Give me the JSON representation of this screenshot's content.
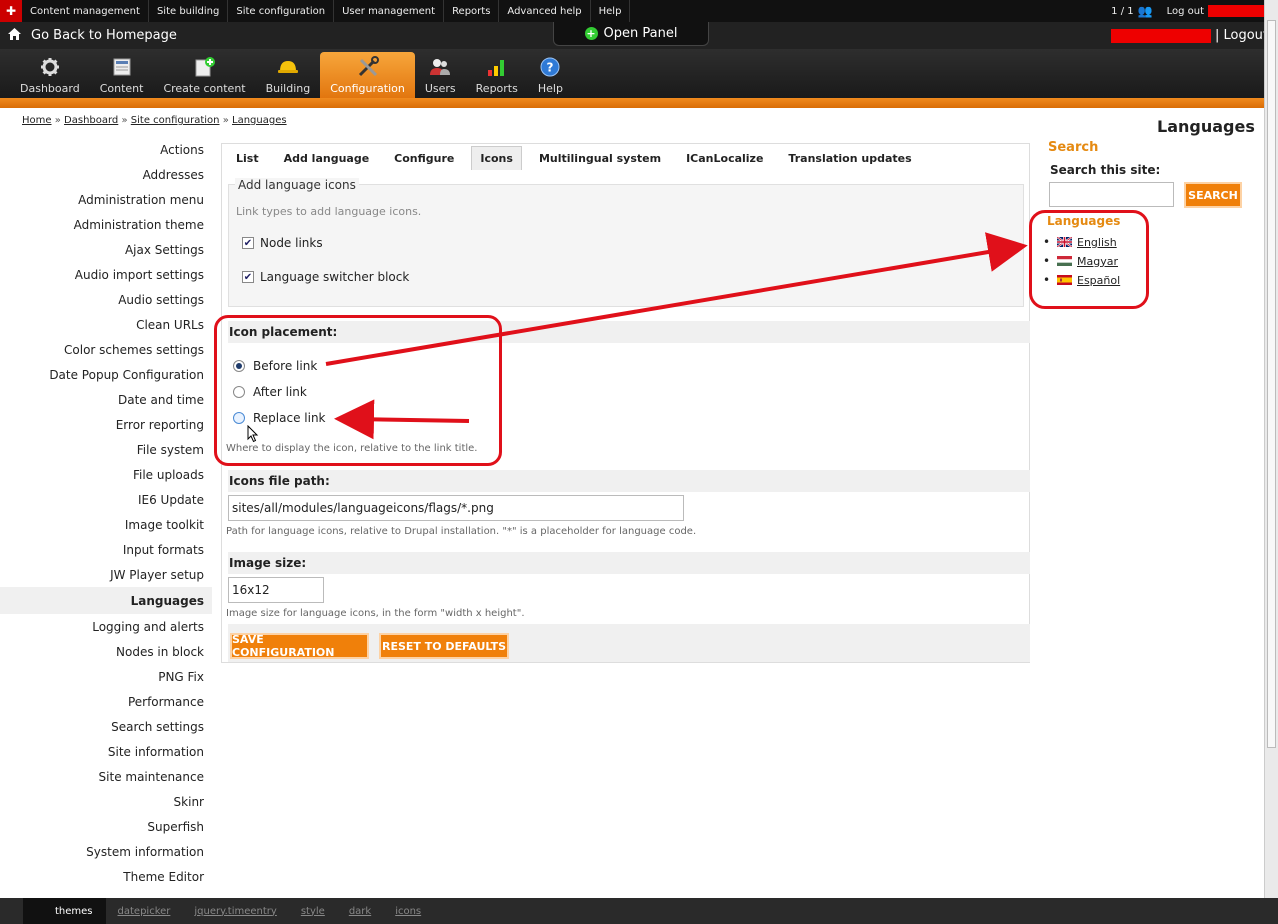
{
  "admin_menu": {
    "items": [
      "Content management",
      "Site building",
      "Site configuration",
      "User management",
      "Reports",
      "Advanced help",
      "Help"
    ],
    "user_count": "1 / 1",
    "logout_label": "Log out"
  },
  "bar2": {
    "home_label": "Go Back to Homepage",
    "open_panel_label": "Open Panel",
    "logout_label": "| Logout"
  },
  "toolbar": {
    "buttons": [
      {
        "label": "Dashboard",
        "icon": "gear-icon"
      },
      {
        "label": "Content",
        "icon": "document-icon"
      },
      {
        "label": "Create content",
        "icon": "add-document-icon"
      },
      {
        "label": "Building",
        "icon": "hard-hat-icon"
      },
      {
        "label": "Configuration",
        "icon": "tools-icon"
      },
      {
        "label": "Users",
        "icon": "users-icon"
      },
      {
        "label": "Reports",
        "icon": "bar-chart-icon"
      },
      {
        "label": "Help",
        "icon": "help-icon"
      }
    ],
    "active": "Configuration"
  },
  "breadcrumb": {
    "items": [
      "Home",
      "Dashboard",
      "Site configuration",
      "Languages"
    ],
    "separator": "»"
  },
  "page_title": "Languages",
  "sidebar": {
    "items": [
      "Actions",
      "Addresses",
      "Administration menu",
      "Administration theme",
      "Ajax Settings",
      "Audio import settings",
      "Audio settings",
      "Clean URLs",
      "Color schemes settings",
      "Date Popup Configuration",
      "Date and time",
      "Error reporting",
      "File system",
      "File uploads",
      "IE6 Update",
      "Image toolkit",
      "Input formats",
      "JW Player setup",
      "Languages",
      "Logging and alerts",
      "Nodes in block",
      "PNG Fix",
      "Performance",
      "Search settings",
      "Site information",
      "Site maintenance",
      "Skinr",
      "Superfish",
      "System information",
      "Theme Editor"
    ],
    "active": "Languages"
  },
  "tabs": {
    "items": [
      "List",
      "Add language",
      "Configure",
      "Icons",
      "Multilingual system",
      "ICanLocalize",
      "Translation updates"
    ],
    "active": "Icons"
  },
  "form": {
    "fieldset_legend": "Add language icons",
    "fieldset_desc": "Link types to add language icons.",
    "checkboxes": [
      {
        "label": "Node links",
        "checked": true
      },
      {
        "label": "Language switcher block",
        "checked": true
      }
    ],
    "icon_placement": {
      "title": "Icon placement:",
      "options": [
        "Before link",
        "After link",
        "Replace link"
      ],
      "selected": "Before link",
      "help": "Where to display the icon, relative to the link title."
    },
    "icons_path": {
      "title": "Icons file path:",
      "value": "sites/all/modules/languageicons/flags/*.png",
      "help": "Path for language icons, relative to Drupal installation. \"*\" is a placeholder for language code."
    },
    "image_size": {
      "title": "Image size:",
      "value": "16x12",
      "help": "Image size for language icons, in the form \"width x height\"."
    },
    "save_label": "SAVE CONFIGURATION",
    "reset_label": "RESET TO DEFAULTS"
  },
  "right": {
    "search_heading": "Search",
    "search_label": "Search this site:",
    "search_button": "SEARCH",
    "languages_heading": "Languages",
    "languages": [
      {
        "name": "English",
        "flag": "uk-flag-icon"
      },
      {
        "name": "Magyar",
        "flag": "hungary-flag-icon"
      },
      {
        "name": "Español",
        "flag": "spain-flag-icon"
      }
    ]
  },
  "bottom_bar": {
    "items": [
      "themes",
      "datepicker",
      "jquery.timeentry",
      "style",
      "dark",
      "icons"
    ],
    "active": "themes"
  },
  "colors": {
    "accent": "#f0800a",
    "annotation": "#e0101a",
    "heading_orange": "#e58a12"
  }
}
